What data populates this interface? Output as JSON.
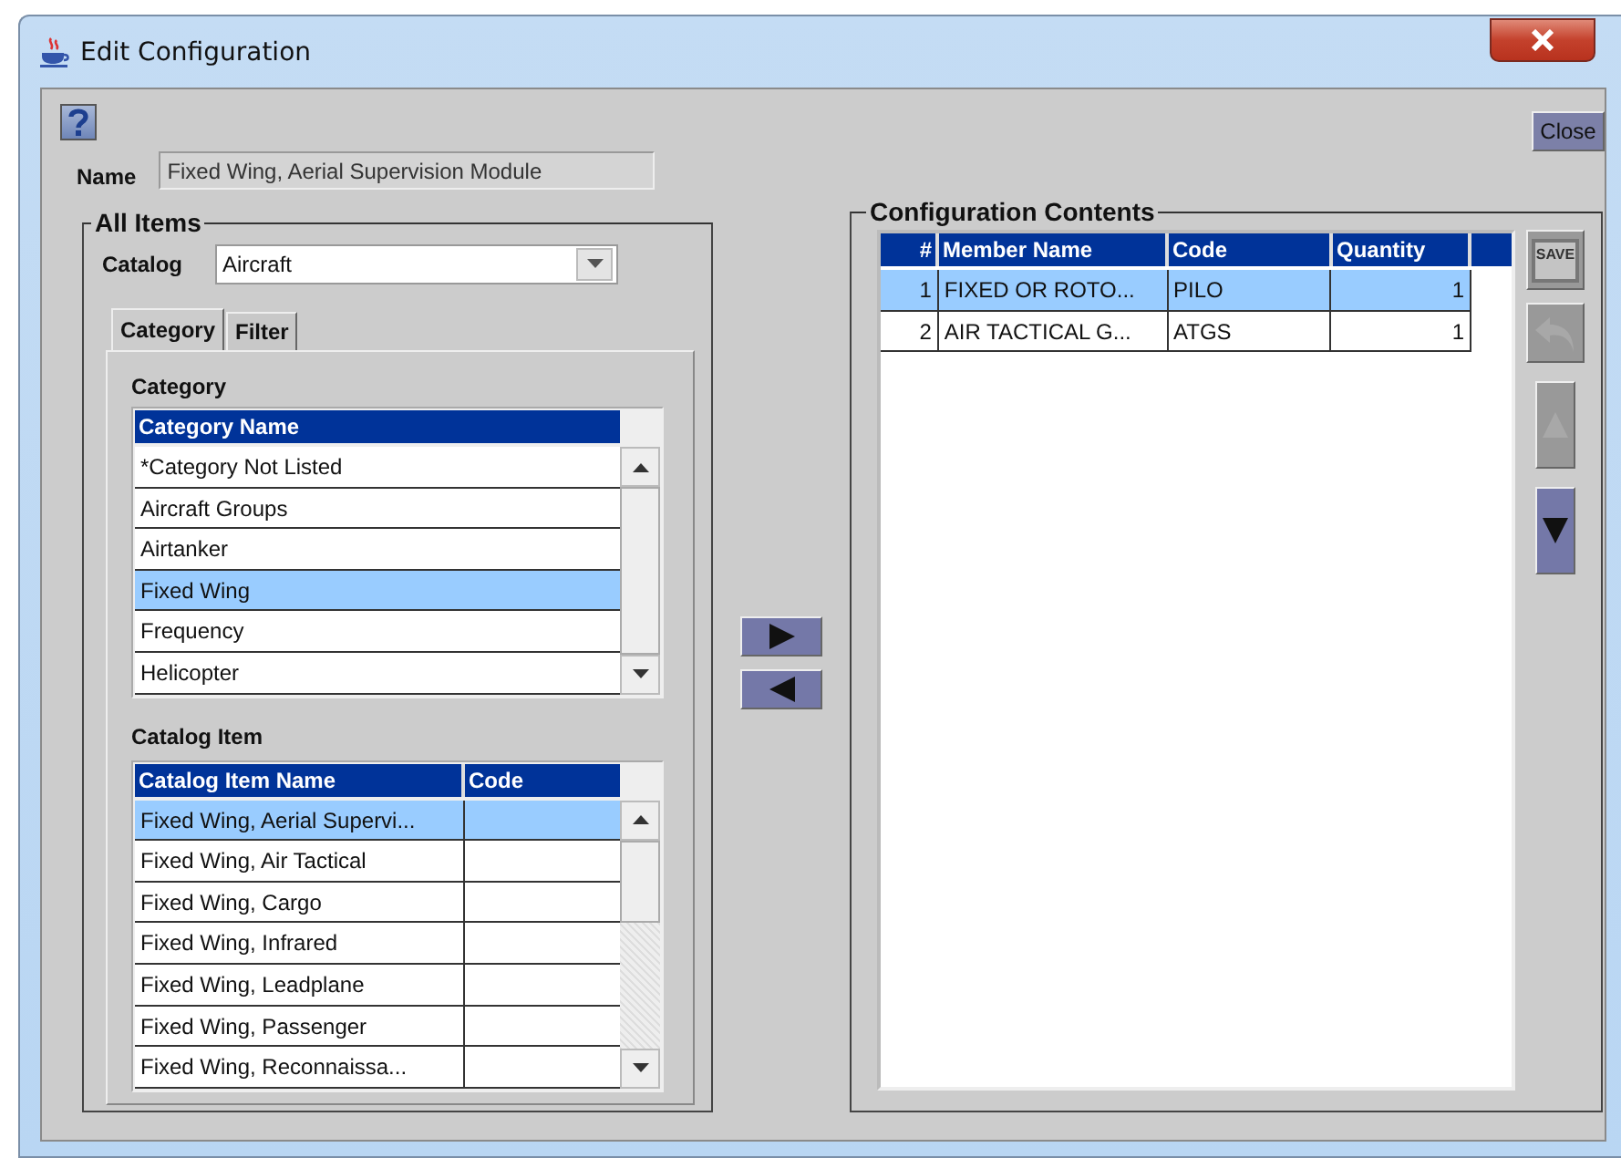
{
  "window": {
    "title": "Edit Configuration"
  },
  "close_button": "Close",
  "name": {
    "label": "Name",
    "value": "Fixed Wing, Aerial Supervision Module"
  },
  "all_items": {
    "title": "All Items",
    "catalog": {
      "label": "Catalog",
      "value": "Aircraft"
    },
    "tabs": [
      {
        "label": "Category",
        "selected": true
      },
      {
        "label": "Filter",
        "selected": false
      }
    ],
    "category": {
      "title": "Category",
      "columns": [
        "Category Name"
      ],
      "rows": [
        {
          "cells": [
            "*Category Not Listed"
          ],
          "selected": false
        },
        {
          "cells": [
            "Aircraft Groups"
          ],
          "selected": false
        },
        {
          "cells": [
            "Airtanker"
          ],
          "selected": false
        },
        {
          "cells": [
            "Fixed Wing"
          ],
          "selected": true
        },
        {
          "cells": [
            "Frequency"
          ],
          "selected": false
        },
        {
          "cells": [
            "Helicopter"
          ],
          "selected": false
        }
      ]
    },
    "catalog_item": {
      "title": "Catalog Item",
      "columns": [
        "Catalog Item Name",
        "Code"
      ],
      "rows": [
        {
          "cells": [
            "Fixed Wing, Aerial Supervi..."
          ],
          "selected": true
        },
        {
          "cells": [
            "Fixed Wing, Air Tactical"
          ],
          "selected": false
        },
        {
          "cells": [
            "Fixed Wing, Cargo"
          ],
          "selected": false
        },
        {
          "cells": [
            "Fixed Wing, Infrared"
          ],
          "selected": false
        },
        {
          "cells": [
            "Fixed Wing, Leadplane"
          ],
          "selected": false
        },
        {
          "cells": [
            "Fixed Wing, Passenger"
          ],
          "selected": false
        },
        {
          "cells": [
            "Fixed Wing, Reconnaissa..."
          ],
          "selected": false
        }
      ]
    }
  },
  "transfer_buttons": [
    {
      "kind": "add"
    },
    {
      "kind": "remove"
    }
  ],
  "configuration_contents": {
    "title": "Configuration Contents",
    "columns": [
      "#",
      "Member Name",
      "Code",
      "Quantity"
    ],
    "rows": [
      {
        "cells": [
          "1",
          "FIXED OR ROTO...",
          "PILO",
          "1"
        ],
        "selected": true
      },
      {
        "cells": [
          "2",
          "AIR TACTICAL G...",
          "ATGS",
          "1"
        ],
        "selected": false
      }
    ]
  },
  "side_buttons": [
    {
      "kind": "save",
      "label": "SAVE",
      "disabled": true
    },
    {
      "kind": "undo",
      "disabled": true
    },
    {
      "kind": "move_up",
      "disabled": true
    },
    {
      "kind": "move_down",
      "disabled": false
    }
  ]
}
